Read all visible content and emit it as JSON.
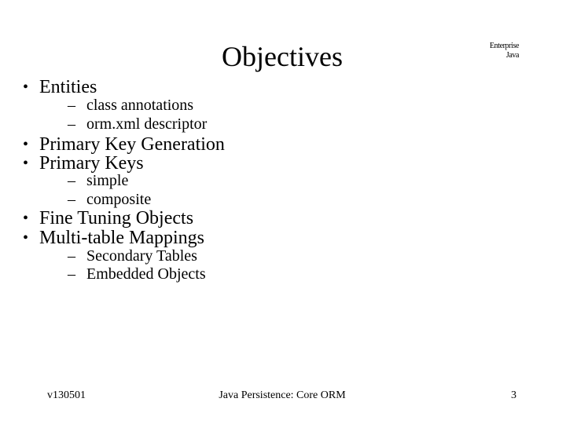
{
  "slide": {
    "title": "Objectives",
    "corner_label": [
      "Enterprise",
      "Java"
    ],
    "outline": [
      {
        "level": 1,
        "text": "Entities",
        "marker": "•"
      },
      {
        "level": 2,
        "text": "class annotations",
        "marker": "–"
      },
      {
        "level": 2,
        "text": "orm.xml descriptor",
        "marker": "–"
      },
      {
        "level": 1,
        "text": "Primary Key Generation",
        "marker": "•"
      },
      {
        "level": 1,
        "text": "Primary Keys",
        "marker": "•"
      },
      {
        "level": 2,
        "text": "simple",
        "marker": "–"
      },
      {
        "level": 2,
        "text": "composite",
        "marker": "–"
      },
      {
        "level": 1,
        "text": "Fine Tuning Objects",
        "marker": "•"
      },
      {
        "level": 1,
        "text": "Multi-table Mappings",
        "marker": "•"
      },
      {
        "level": 2,
        "text": "Secondary Tables",
        "marker": "–"
      },
      {
        "level": 2,
        "text": "Embedded Objects",
        "marker": "–"
      }
    ],
    "footer": {
      "version": "v130501",
      "course": "Java Persistence: Core ORM",
      "page_number": "3"
    }
  }
}
